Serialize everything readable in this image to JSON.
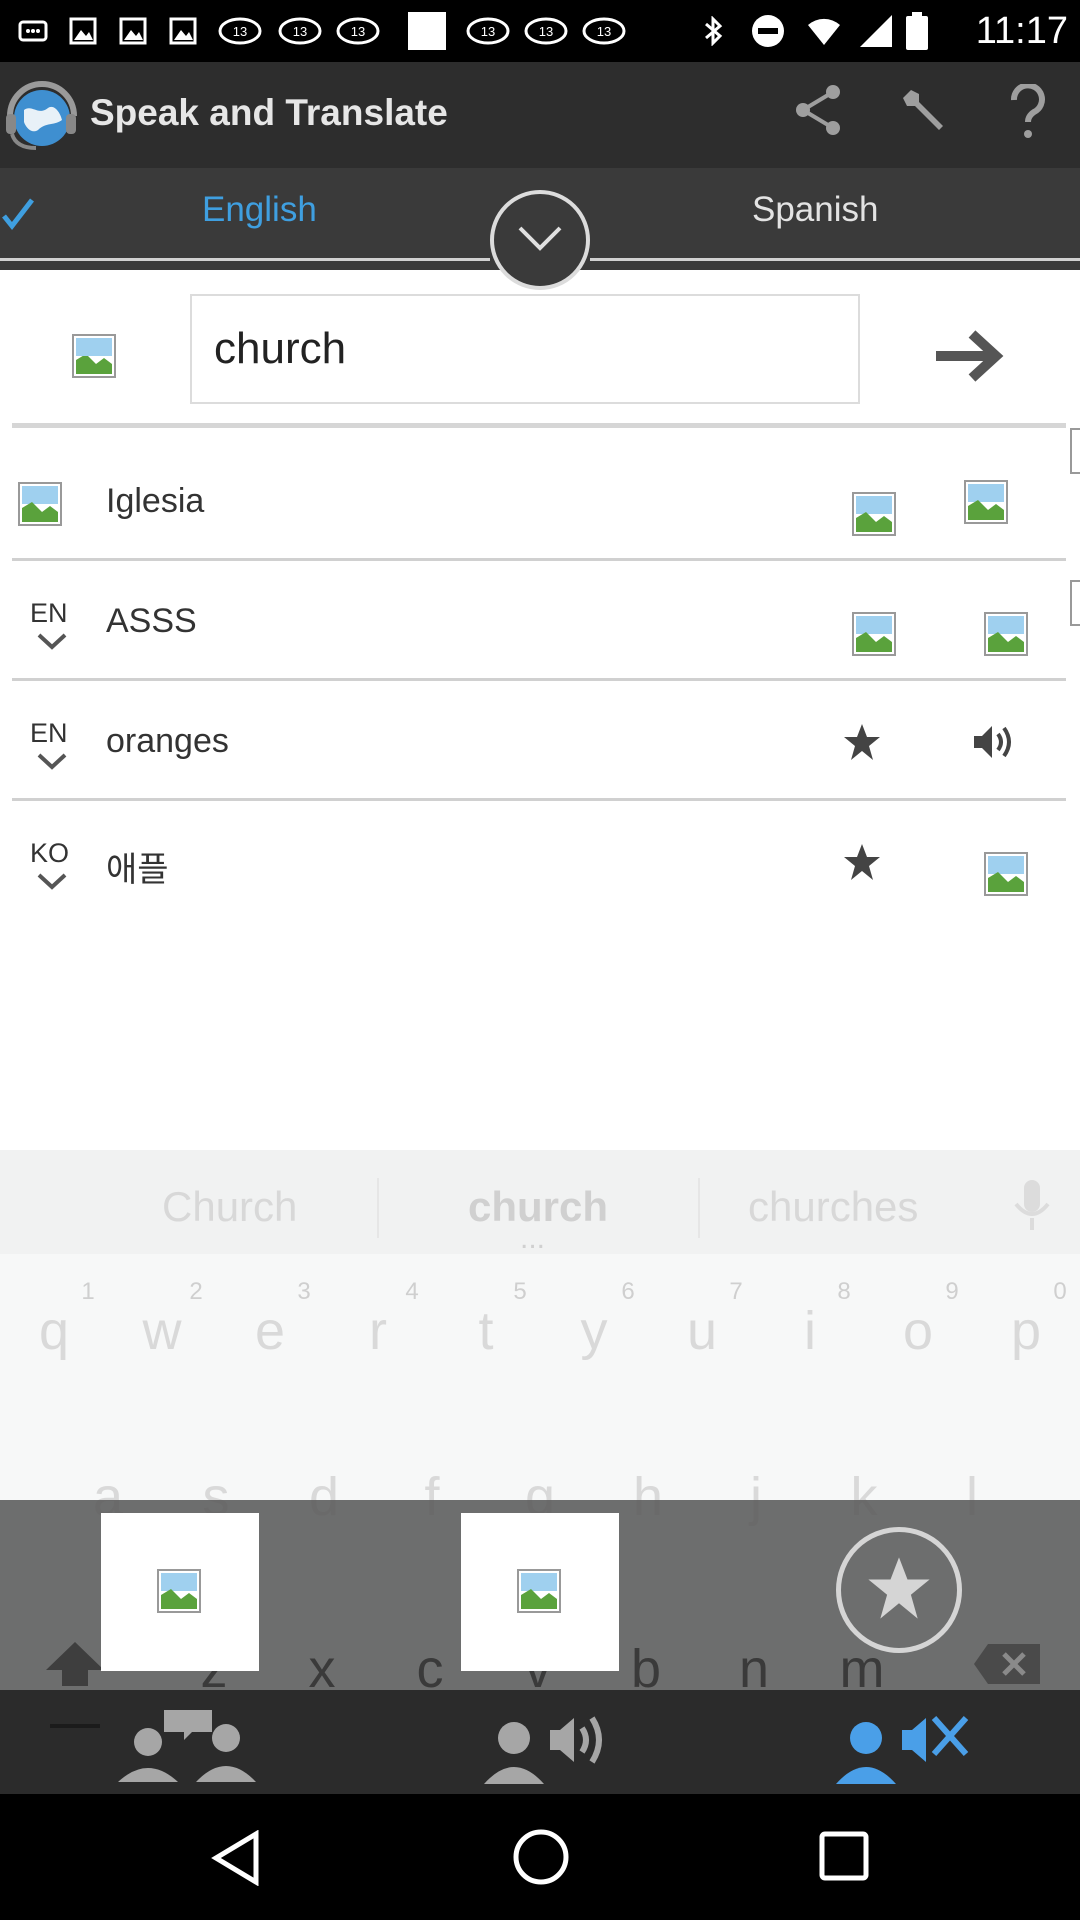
{
  "status_bar": {
    "time": "11:17",
    "icons": [
      "notification-icon",
      "image-icon",
      "abc13-icon",
      "gallery-icon",
      "abc13-icon",
      "abc13-icon",
      "abc13-icon",
      "bluetooth-icon",
      "do-not-disturb-icon",
      "wifi-icon",
      "signal-icon",
      "battery-icon"
    ]
  },
  "app_bar": {
    "title": "Speak and Translate",
    "actions": [
      "share-icon",
      "wrench-icon",
      "help-icon"
    ]
  },
  "languages": {
    "source": "English",
    "target": "Spanish"
  },
  "input": {
    "value": "church"
  },
  "history": [
    {
      "lang": "",
      "text": "Iglesia"
    },
    {
      "lang": "EN",
      "text": "ASSS"
    },
    {
      "lang": "EN",
      "text": "oranges"
    },
    {
      "lang": "KO",
      "text": "애플"
    }
  ],
  "keyboard": {
    "suggestions": [
      "Church",
      "church",
      "churches"
    ],
    "more_indicator": "...",
    "numbers": [
      "1",
      "2",
      "3",
      "4",
      "5",
      "6",
      "7",
      "8",
      "9",
      "0"
    ],
    "row1": [
      "q",
      "w",
      "e",
      "r",
      "t",
      "y",
      "u",
      "i",
      "o",
      "p"
    ],
    "row2": [
      "a",
      "s",
      "d",
      "f",
      "g",
      "h",
      "j",
      "k",
      "l"
    ],
    "row3": [
      "z",
      "x",
      "c",
      "v",
      "b",
      "n",
      "m"
    ]
  },
  "colors": {
    "accent": "#3f9fe0",
    "app_bar": "#2d2d2d",
    "lang_bar": "#3a3a3a"
  }
}
